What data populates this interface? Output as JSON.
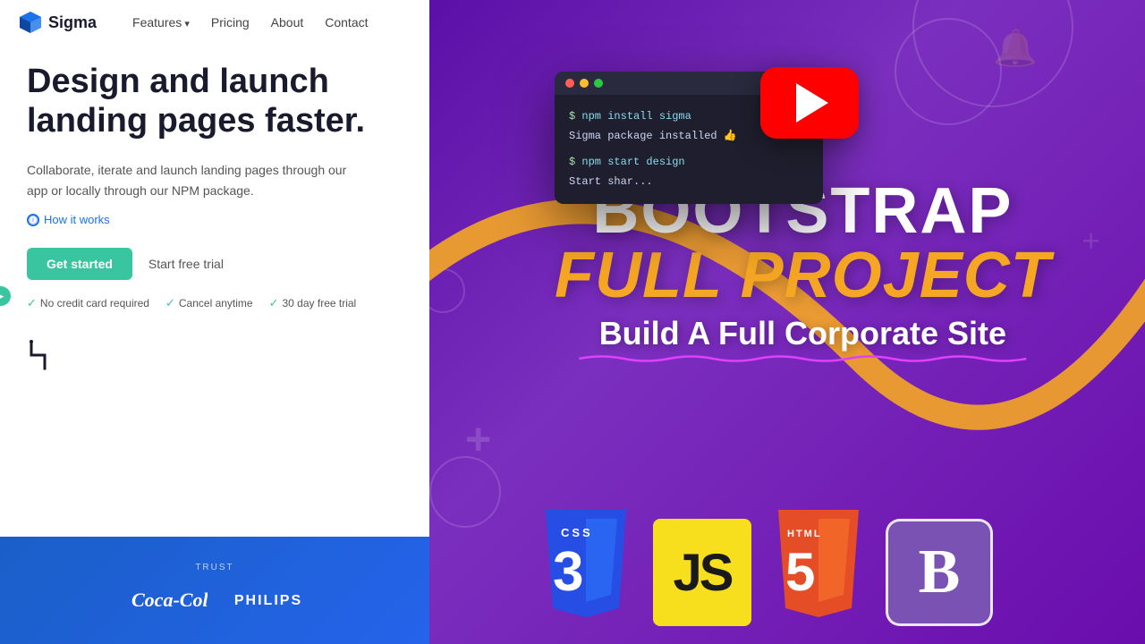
{
  "nav": {
    "logo_text": "Sigma",
    "features_label": "Features",
    "pricing_label": "Pricing",
    "about_label": "About",
    "contact_label": "Contact"
  },
  "hero": {
    "title": "Design and launch landing pages faster.",
    "description": "Collaborate, iterate and launch landing pages through our app or locally through our NPM package.",
    "how_it_works": "How it works",
    "cta_button": "Get started",
    "free_trial": "Start free trial",
    "badge1": "No credit card required",
    "badge2": "Cancel anytime",
    "badge3": "30 day free trial"
  },
  "terminal": {
    "line1_prompt": "$ ",
    "line1_cmd": "npm install sigma",
    "line2_output": "Sigma package installed 👍",
    "line3_prompt": "$ ",
    "line3_cmd": "npm start design",
    "line4_output": "Start shar..."
  },
  "trusted": {
    "label": "TRUST",
    "logo1": "Coca-Cola",
    "logo2": "PHILIPS"
  },
  "thumbnail": {
    "bootstrap_text": "BOOTSTRAP",
    "full_project_text": "FULL PROJECT",
    "build_text": "Build A Full Corporate Site",
    "tech_icons": [
      {
        "name": "CSS",
        "label": "CSS",
        "number": "3",
        "type": "css"
      },
      {
        "name": "JavaScript",
        "label": "JS",
        "type": "js"
      },
      {
        "name": "HTML",
        "label": "HTML",
        "number": "5",
        "type": "html"
      },
      {
        "name": "Bootstrap",
        "label": "B",
        "type": "bootstrap"
      }
    ]
  },
  "colors": {
    "accent_green": "#38c5a0",
    "accent_blue": "#1a73e8",
    "purple_bg": "#6a0dad",
    "gold": "#f5a623",
    "yt_red": "#ff0000"
  }
}
